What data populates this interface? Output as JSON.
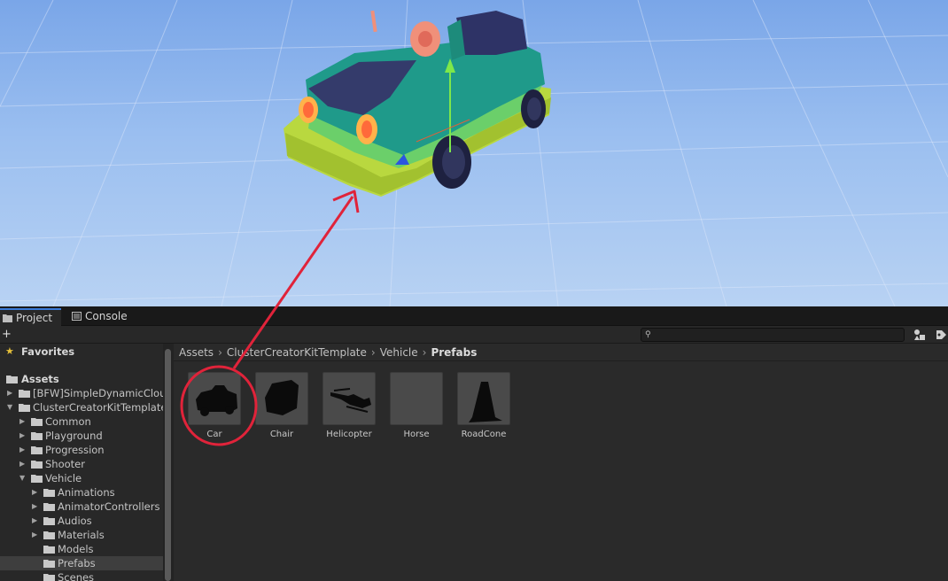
{
  "tabs": [
    {
      "label": "Project",
      "active": true
    },
    {
      "label": "Console",
      "active": false
    }
  ],
  "toolbar": {
    "add_label": "+ ▾",
    "search_value": "",
    "search_placeholder": ""
  },
  "tree": {
    "favorites_label": "Favorites",
    "assets_label": "Assets",
    "items": [
      {
        "label": "[BFW]SimpleDynamicClou",
        "depth": 1,
        "expanded": false
      },
      {
        "label": "ClusterCreatorKitTemplate",
        "depth": 1,
        "expanded": true
      },
      {
        "label": "Common",
        "depth": 2,
        "expanded": false
      },
      {
        "label": "Playground",
        "depth": 2,
        "expanded": false
      },
      {
        "label": "Progression",
        "depth": 2,
        "expanded": false
      },
      {
        "label": "Shooter",
        "depth": 2,
        "expanded": false
      },
      {
        "label": "Vehicle",
        "depth": 2,
        "expanded": true
      },
      {
        "label": "Animations",
        "depth": 3,
        "expanded": false
      },
      {
        "label": "AnimatorControllers",
        "depth": 3,
        "expanded": false
      },
      {
        "label": "Audios",
        "depth": 3,
        "expanded": false
      },
      {
        "label": "Materials",
        "depth": 3,
        "expanded": false
      },
      {
        "label": "Models",
        "depth": 3,
        "expanded": false
      },
      {
        "label": "Prefabs",
        "depth": 3,
        "expanded": false,
        "selected": true
      },
      {
        "label": "Scenes",
        "depth": 3,
        "expanded": false
      }
    ]
  },
  "breadcrumb": [
    "Assets",
    "ClusterCreatorKitTemplate",
    "Vehicle",
    "Prefabs"
  ],
  "assets": [
    {
      "name": "Car",
      "icon": "car-silhouette-icon"
    },
    {
      "name": "Chair",
      "icon": "chair-silhouette-icon"
    },
    {
      "name": "Helicopter",
      "icon": "helicopter-silhouette-icon"
    },
    {
      "name": "Horse",
      "icon": "empty-preview"
    },
    {
      "name": "RoadCone",
      "icon": "road-cone-silhouette-icon"
    }
  ],
  "colors": {
    "sky": "#9bbff0",
    "car_body": "#1f9a8a",
    "car_bumper": "#c9e052",
    "annotation": "#e0233a",
    "selection": "#3e3e3e"
  }
}
